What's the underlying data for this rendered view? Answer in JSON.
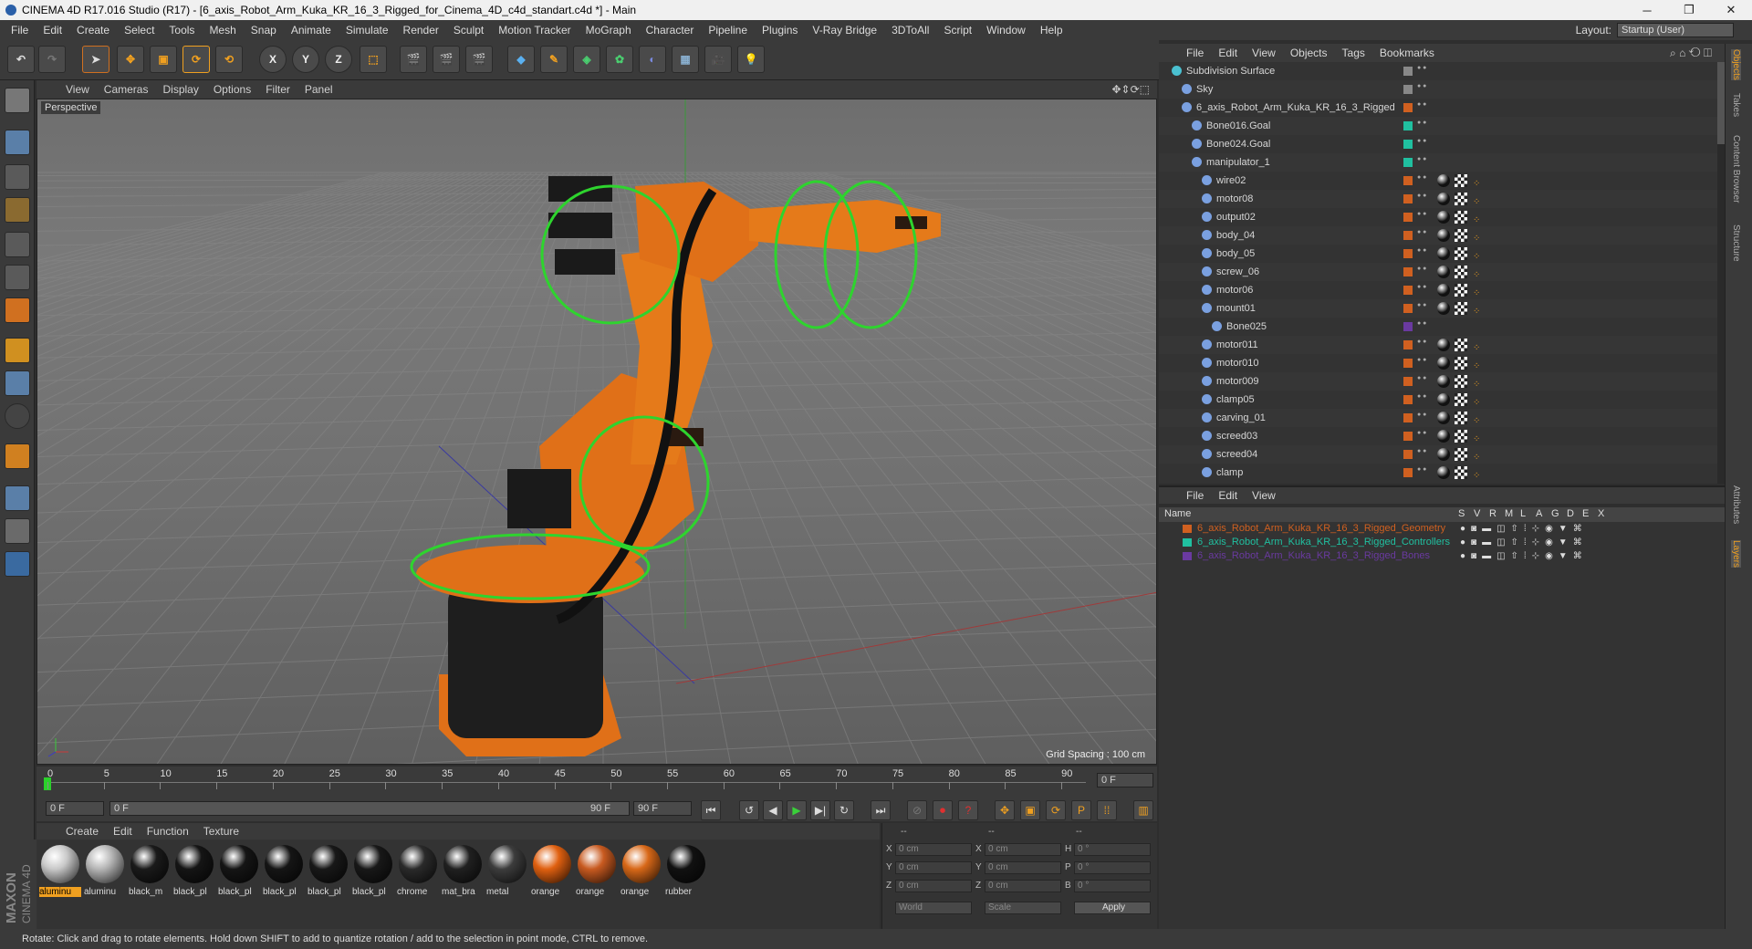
{
  "window": {
    "title": "CINEMA 4D R17.016 Studio (R17) - [6_axis_Robot_Arm_Kuka_KR_16_3_Rigged_for_Cinema_4D_c4d_standart.c4d *] - Main",
    "minimize": "─",
    "maximize": "❐",
    "close": "✕"
  },
  "menu": [
    "File",
    "Edit",
    "Create",
    "Select",
    "Tools",
    "Mesh",
    "Snap",
    "Animate",
    "Simulate",
    "Render",
    "Sculpt",
    "Motion Tracker",
    "MoGraph",
    "Character",
    "Pipeline",
    "Plugins",
    "V-Ray Bridge",
    "3DToAll",
    "Script",
    "Window",
    "Help"
  ],
  "layout": {
    "label": "Layout:",
    "value": "Startup (User)"
  },
  "toolbar": {
    "undo_icon": "undo-icon",
    "x_label": "X",
    "y_label": "Y",
    "z_label": "Z"
  },
  "viewport": {
    "menu": [
      "View",
      "Cameras",
      "Display",
      "Options",
      "Filter",
      "Panel"
    ],
    "label": "Perspective",
    "grid_spacing": "Grid Spacing : 100 cm"
  },
  "timeline": {
    "ticks": [
      "0",
      "5",
      "10",
      "15",
      "20",
      "25",
      "30",
      "35",
      "40",
      "45",
      "50",
      "55",
      "60",
      "65",
      "70",
      "75",
      "80",
      "85",
      "90"
    ],
    "current_frame": "0 F",
    "start": "0 F",
    "range_start": "0 F",
    "range_end": "90 F",
    "end": "90 F"
  },
  "materials": {
    "menu": [
      "Create",
      "Edit",
      "Function",
      "Texture"
    ],
    "items": [
      {
        "name": "aluminu",
        "color": "#c8c8c8",
        "selected": true
      },
      {
        "name": "aluminu",
        "color": "#b5b5b5"
      },
      {
        "name": "black_m",
        "color": "#1a1a1a"
      },
      {
        "name": "black_pl",
        "color": "#151515"
      },
      {
        "name": "black_pl",
        "color": "#151515"
      },
      {
        "name": "black_pl",
        "color": "#151515"
      },
      {
        "name": "black_pl",
        "color": "#181818"
      },
      {
        "name": "black_pl",
        "color": "#181818"
      },
      {
        "name": "chrome",
        "color": "#2a2a2a"
      },
      {
        "name": "mat_bra",
        "color": "#202020"
      },
      {
        "name": "metal",
        "color": "#3c3c3c"
      },
      {
        "name": "orange",
        "color": "#e06010"
      },
      {
        "name": "orange",
        "color": "#c85a20"
      },
      {
        "name": "orange",
        "color": "#d86818"
      },
      {
        "name": "rubber",
        "color": "#111111"
      }
    ]
  },
  "coords": {
    "headers": [
      "--",
      "--",
      "--"
    ],
    "rows": [
      {
        "axis": "X",
        "pos": "0 cm",
        "axis2": "X",
        "size": "0 cm",
        "rot_axis": "H",
        "rot": "0 °"
      },
      {
        "axis": "Y",
        "pos": "0 cm",
        "axis2": "Y",
        "size": "0 cm",
        "rot_axis": "P",
        "rot": "0 °"
      },
      {
        "axis": "Z",
        "pos": "0 cm",
        "axis2": "Z",
        "size": "0 cm",
        "rot_axis": "B",
        "rot": "0 °"
      }
    ],
    "mode": "World",
    "scale": "Scale",
    "apply": "Apply"
  },
  "status": "Rotate: Click and drag to rotate elements. Hold down SHIFT to add to quantize rotation / add to the selection in point mode, CTRL to remove.",
  "brand": {
    "top": "MAXON",
    "bottom": "CINEMA 4D"
  },
  "objects": {
    "menu": [
      "File",
      "Edit",
      "View",
      "Objects",
      "Tags",
      "Bookmarks"
    ],
    "items": [
      {
        "name": "Subdivision Surface",
        "depth": 0,
        "color": "#888888"
      },
      {
        "name": "Sky",
        "depth": 1,
        "color": "#888888"
      },
      {
        "name": "6_axis_Robot_Arm_Kuka_KR_16_3_Rigged",
        "depth": 1,
        "color": "#d06020"
      },
      {
        "name": "Bone016.Goal",
        "depth": 2,
        "color": "#20c0a0"
      },
      {
        "name": "Bone024.Goal",
        "depth": 2,
        "color": "#20c0a0"
      },
      {
        "name": "manipulator_1",
        "depth": 2,
        "color": "#20c0a0"
      },
      {
        "name": "wire02",
        "depth": 3,
        "color": "#d06020"
      },
      {
        "name": "motor08",
        "depth": 3,
        "color": "#d06020"
      },
      {
        "name": "output02",
        "depth": 3,
        "color": "#d06020"
      },
      {
        "name": "body_04",
        "depth": 3,
        "color": "#d06020"
      },
      {
        "name": "body_05",
        "depth": 3,
        "color": "#d06020"
      },
      {
        "name": "screw_06",
        "depth": 3,
        "color": "#d06020"
      },
      {
        "name": "motor06",
        "depth": 3,
        "color": "#d06020"
      },
      {
        "name": "mount01",
        "depth": 3,
        "color": "#d06020"
      },
      {
        "name": "Bone025",
        "depth": 4,
        "color": "#6a3aa0"
      },
      {
        "name": "motor011",
        "depth": 3,
        "color": "#d06020"
      },
      {
        "name": "motor010",
        "depth": 3,
        "color": "#d06020"
      },
      {
        "name": "motor009",
        "depth": 3,
        "color": "#d06020"
      },
      {
        "name": "clamp05",
        "depth": 3,
        "color": "#d06020"
      },
      {
        "name": "carving_01",
        "depth": 3,
        "color": "#d06020"
      },
      {
        "name": "screed03",
        "depth": 3,
        "color": "#d06020"
      },
      {
        "name": "screed04",
        "depth": 3,
        "color": "#d06020"
      },
      {
        "name": "clamp",
        "depth": 3,
        "color": "#d06020"
      }
    ]
  },
  "layers": {
    "menu": [
      "File",
      "Edit",
      "View"
    ],
    "headers": [
      "Name",
      "S",
      "V",
      "R",
      "M",
      "L",
      "A",
      "G",
      "D",
      "E",
      "X"
    ],
    "items": [
      {
        "name": "6_axis_Robot_Arm_Kuka_KR_16_3_Rigged_Geometry",
        "color": "#d06020"
      },
      {
        "name": "6_axis_Robot_Arm_Kuka_KR_16_3_Rigged_Controllers",
        "color": "#20c0a0"
      },
      {
        "name": "6_axis_Robot_Arm_Kuka_KR_16_3_Rigged_Bones",
        "color": "#6a3aa0"
      }
    ]
  },
  "side_tabs": [
    "Objects",
    "Takes",
    "Content Browser",
    "Structure",
    "Attributes",
    "Layers"
  ]
}
